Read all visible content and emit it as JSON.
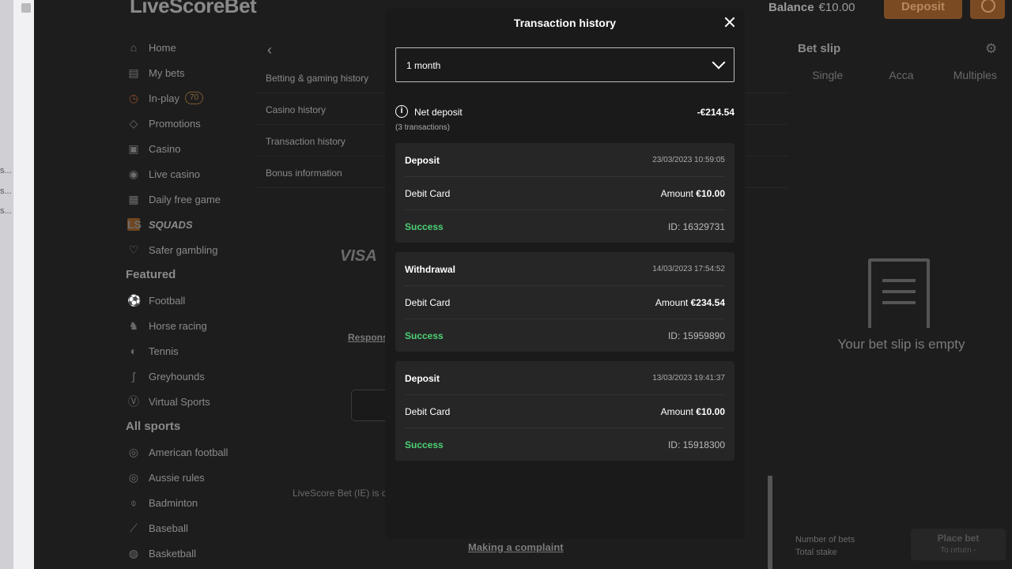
{
  "header": {
    "logo": "LiveScoreBet",
    "balance_label": "Balance",
    "balance_value": "€10.00",
    "deposit_label": "Deposit"
  },
  "sidebar": {
    "items": [
      {
        "label": "Home",
        "icon": "home-icon"
      },
      {
        "label": "My bets",
        "icon": "receipt-icon"
      },
      {
        "label": "In-play",
        "icon": "clock-icon",
        "badge": "70"
      },
      {
        "label": "Promotions",
        "icon": "tag-icon"
      },
      {
        "label": "Casino",
        "icon": "cards-icon"
      },
      {
        "label": "Live casino",
        "icon": "live-icon"
      },
      {
        "label": "Daily free game",
        "icon": "game-icon"
      },
      {
        "label": "SQUADS",
        "icon": "squads-icon"
      },
      {
        "label": "Safer gambling",
        "icon": "heart-icon"
      }
    ],
    "featured_heading": "Featured",
    "featured": [
      {
        "label": "Football",
        "icon": "football-icon"
      },
      {
        "label": "Horse racing",
        "icon": "horse-icon"
      },
      {
        "label": "Tennis",
        "icon": "tennis-icon"
      },
      {
        "label": "Greyhounds",
        "icon": "greyhound-icon"
      },
      {
        "label": "Virtual Sports",
        "icon": "virtual-icon"
      }
    ],
    "all_sports_heading": "All sports",
    "all_sports": [
      {
        "label": "American football",
        "icon": "american-football-icon"
      },
      {
        "label": "Aussie rules",
        "icon": "aussie-rules-icon"
      },
      {
        "label": "Badminton",
        "icon": "badminton-icon"
      },
      {
        "label": "Baseball",
        "icon": "baseball-icon"
      },
      {
        "label": "Basketball",
        "icon": "basketball-icon"
      }
    ]
  },
  "account": {
    "menu": [
      "Betting & gaming history",
      "Casino history",
      "Transaction history",
      "Bonus information"
    ],
    "visa": "VISA",
    "respons": "Respons",
    "footer": "LiveScore Bet (IE) is c",
    "complaint": "Making a complaint"
  },
  "betslip": {
    "title": "Bet slip",
    "tabs": [
      "Single",
      "Acca",
      "Multiples"
    ],
    "empty": "Your bet slip is empty",
    "number_of_bets": "Number of bets",
    "total_stake": "Total stake",
    "place_bet": "Place bet",
    "to_return": "To return -"
  },
  "modal": {
    "title": "Transaction history",
    "period": "1 month",
    "net_label": "Net deposit",
    "net_count": "(3 transactions)",
    "net_amount": "-€214.54",
    "amount_label": "Amount",
    "transactions": [
      {
        "type": "Deposit",
        "date": "23/03/2023 10:59:05",
        "method": "Debit Card",
        "amount": "€10.00",
        "status": "Success",
        "id": "ID: 16329731"
      },
      {
        "type": "Withdrawal",
        "date": "14/03/2023 17:54:52",
        "method": "Debit Card",
        "amount": "€234.54",
        "status": "Success",
        "id": "ID: 15959890"
      },
      {
        "type": "Deposit",
        "date": "13/03/2023 19:41:37",
        "method": "Debit Card",
        "amount": "€10.00",
        "status": "Success",
        "id": "ID: 15918300"
      }
    ]
  },
  "colors": {
    "success": "#4cd175",
    "background": "#1d1d1d",
    "modal": "#1a1a1a",
    "card": "#262626",
    "accent": "#7a4b23"
  }
}
